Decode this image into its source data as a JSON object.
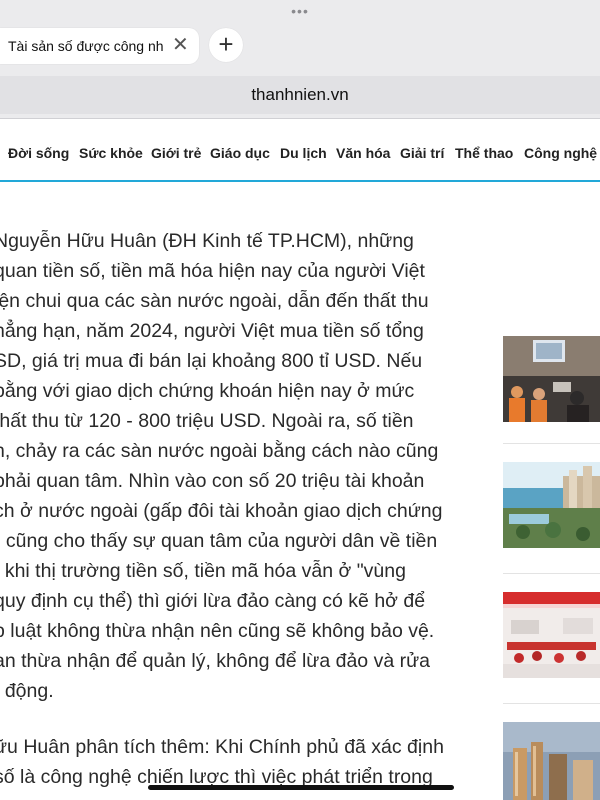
{
  "browser": {
    "tab_title": "Tài sản số được công nh",
    "close_glyph": "✕",
    "new_tab_glyph": "+",
    "url": "thanhnien.vn",
    "dots": "•••"
  },
  "nav": {
    "items": [
      "Đời sống",
      "Sức khỏe",
      "Giới trẻ",
      "Giáo dục",
      "Du lịch",
      "Văn hóa",
      "Giải trí",
      "Thể thao",
      "Công nghệ"
    ],
    "accent_color": "#22a8d8"
  },
  "article": {
    "paragraph1": [
      "Nguyễn Hữu Huân (ĐH Kinh tế TP.HCM), những",
      "quan tiền số, tiền mã hóa hiện nay của người Việt",
      "iện chui qua các sàn nước ngoài, dẫn đến thất thu",
      "hẳng hạn, năm 2024, người Việt mua tiền số tổng",
      "SD, giá trị mua đi bán lại khoảng 800 tỉ USD. Nếu",
      "bằng với giao dịch chứng khoán hiện nay ở mức",
      "thất thu từ 120 - 800 triệu USD. Ngoài ra, số tiền",
      "n, chảy ra các sàn nước ngoài bằng cách nào cũng",
      "phải quan tâm. Nhìn vào con số 20 triệu tài khoản",
      "ch ở nước ngoài (gấp đôi tài khoản giao dịch chứng",
      ") cũng cho thấy sự quan tâm của người dân về tiền",
      ", khi thị trường tiền số, tiền mã hóa vẫn ở \"vùng",
      "quy định cụ thể) thì giới lừa đảo càng có kẽ hở để",
      "p luật không thừa nhận nên cũng sẽ không bảo vệ.",
      "an thừa nhận để quản lý, không để lừa đảo và rửa",
      "t động."
    ],
    "paragraph2": [
      "ữu Huân phân tích thêm: Khi Chính phủ đã xác định",
      "số là công nghệ chiến lược thì việc phát triển trong"
    ]
  }
}
